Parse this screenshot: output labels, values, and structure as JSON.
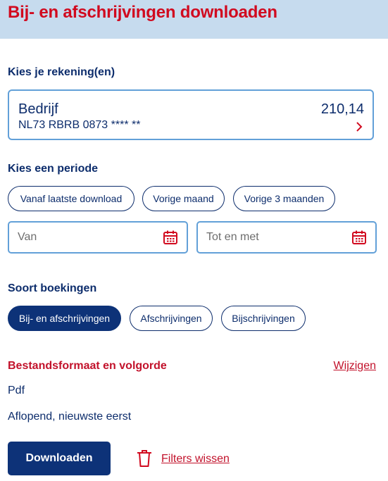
{
  "header": {
    "title": "Bij- en afschrijvingen downloaden"
  },
  "accounts": {
    "section_title": "Kies je rekening(en)",
    "selected": {
      "name": "Bedrijf",
      "iban": "NL73 RBRB 0873 **** **",
      "balance": "210,14"
    }
  },
  "period": {
    "section_title": "Kies een periode",
    "presets": [
      "Vanaf laatste download",
      "Vorige maand",
      "Vorige 3 maanden"
    ],
    "from_placeholder": "Van",
    "to_placeholder": "Tot en met"
  },
  "booking_type": {
    "section_title": "Soort boekingen",
    "options": [
      "Bij- en afschrijvingen",
      "Afschrijvingen",
      "Bijschrijvingen"
    ],
    "selected_index": 0
  },
  "file_format": {
    "section_title": "Bestandsformaat en volgorde",
    "change_link": "Wijzigen",
    "format": "Pdf",
    "order": "Aflopend, nieuwste eerst"
  },
  "actions": {
    "download_label": "Downloaden",
    "clear_filters_label": "Filters wissen"
  },
  "colors": {
    "brand_blue": "#0d3278",
    "brand_red": "#d10a1f",
    "header_bg": "#c6dbee",
    "input_border": "#62a0d8"
  }
}
